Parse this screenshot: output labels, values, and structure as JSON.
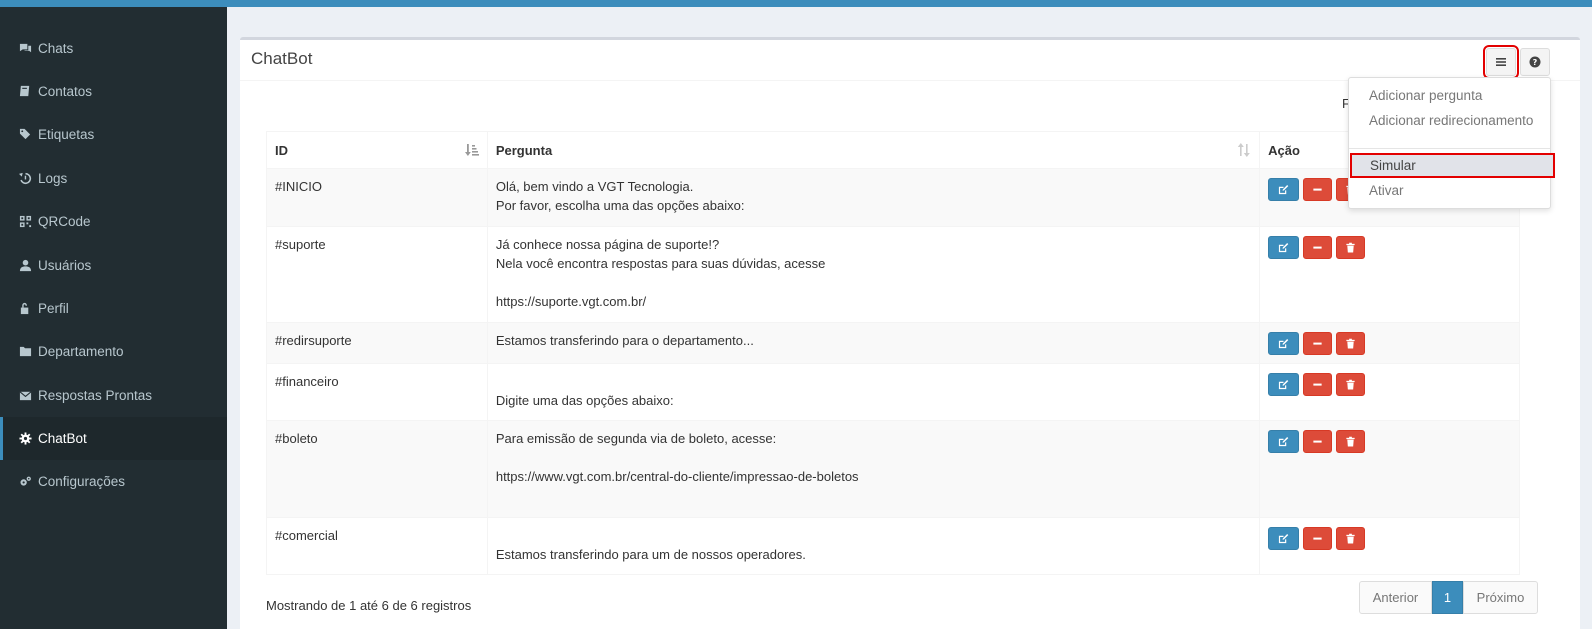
{
  "sidebar": {
    "items": [
      {
        "label": "Chats",
        "icon": "comments-icon"
      },
      {
        "label": "Contatos",
        "icon": "book-icon"
      },
      {
        "label": "Etiquetas",
        "icon": "tags-icon"
      },
      {
        "label": "Logs",
        "icon": "history-icon"
      },
      {
        "label": "QRCode",
        "icon": "qrcode-icon"
      },
      {
        "label": "Usuários",
        "icon": "user-icon"
      },
      {
        "label": "Perfil",
        "icon": "unlock-icon"
      },
      {
        "label": "Departamento",
        "icon": "folder-icon"
      },
      {
        "label": "Respostas Prontas",
        "icon": "envelope-icon"
      },
      {
        "label": "ChatBot",
        "icon": "cog-icon",
        "active": true
      },
      {
        "label": "Configurações",
        "icon": "cogs-icon"
      }
    ]
  },
  "box": {
    "title": "ChatBot",
    "filter_label": "F"
  },
  "menu": {
    "items": [
      "Adicionar pergunta",
      "Adicionar redirecionamento",
      "Simular",
      "Ativar"
    ],
    "highlighted": "Simular"
  },
  "table": {
    "headers": {
      "id": "ID",
      "pergunta": "Pergunta",
      "acao": "Ação"
    },
    "rows": [
      {
        "id": "#INICIO",
        "lines": [
          "Olá, bem vindo a VGT Tecnologia.",
          "Por favor, escolha uma das opções abaixo:"
        ]
      },
      {
        "id": "#suporte",
        "lines": [
          "Já conhece nossa página de suporte!?",
          "Nela você encontra respostas para suas dúvidas, acesse",
          "",
          "https://suporte.vgt.com.br/"
        ]
      },
      {
        "id": "#redirsuporte",
        "lines": [
          "Estamos transferindo para o departamento..."
        ]
      },
      {
        "id": "#financeiro",
        "lines": [
          "",
          "Digite uma das opções abaixo:"
        ]
      },
      {
        "id": "#boleto",
        "lines": [
          "Para emissão de segunda via de boleto, acesse:",
          "",
          "https://www.vgt.com.br/central-do-cliente/impressao-de-boletos",
          ""
        ]
      },
      {
        "id": "#comercial",
        "lines": [
          "",
          "Estamos transferindo para um de nossos operadores."
        ]
      }
    ]
  },
  "footer": {
    "info": "Mostrando de 1 até 6 de 6 registros",
    "prev": "Anterior",
    "page": "1",
    "next": "Próximo"
  },
  "colors": {
    "sidebar_bg": "#222d32",
    "accent": "#3c8dbc",
    "danger": "#dd4b39",
    "highlight_outline": "#e30000"
  }
}
